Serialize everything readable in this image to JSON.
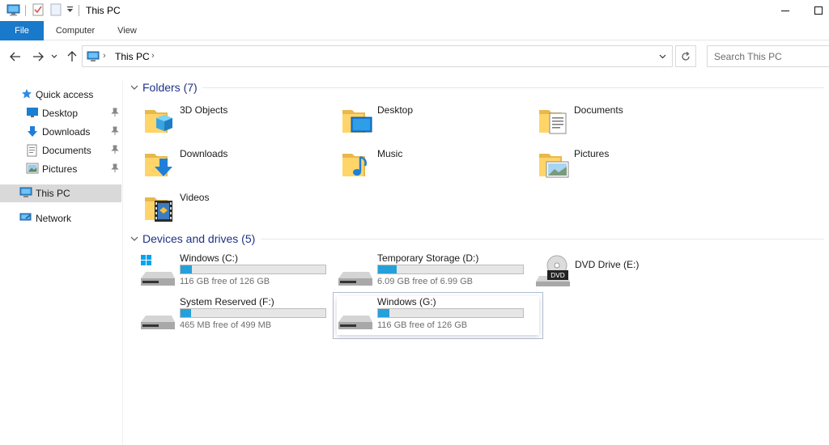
{
  "window": {
    "title": "This PC"
  },
  "ribbon": {
    "tabs": [
      {
        "label": "File"
      },
      {
        "label": "Computer"
      },
      {
        "label": "View"
      }
    ]
  },
  "address": {
    "location": "This PC",
    "search_placeholder": "Search This PC"
  },
  "nav": {
    "quick_access": "Quick access",
    "items": [
      {
        "label": "Desktop"
      },
      {
        "label": "Downloads"
      },
      {
        "label": "Documents"
      },
      {
        "label": "Pictures"
      }
    ],
    "this_pc": "This PC",
    "network": "Network"
  },
  "folders": {
    "heading": "Folders (7)",
    "items": [
      {
        "name": "3D Objects",
        "icon": "3d-objects-folder-icon"
      },
      {
        "name": "Desktop",
        "icon": "desktop-folder-icon"
      },
      {
        "name": "Documents",
        "icon": "documents-folder-icon"
      },
      {
        "name": "Downloads",
        "icon": "downloads-folder-icon"
      },
      {
        "name": "Music",
        "icon": "music-folder-icon"
      },
      {
        "name": "Pictures",
        "icon": "pictures-folder-icon"
      },
      {
        "name": "Videos",
        "icon": "videos-folder-icon"
      }
    ]
  },
  "drives": {
    "heading": "Devices and drives (5)",
    "items": [
      {
        "name": "Windows (C:)",
        "free": "116 GB free of 126 GB",
        "used_fraction": 0.08
      },
      {
        "name": "Temporary Storage (D:)",
        "free": "6.09 GB free of 6.99 GB",
        "used_fraction": 0.13
      },
      {
        "name": "DVD Drive (E:)"
      },
      {
        "name": "System Reserved (F:)",
        "free": "465 MB free of 499 MB",
        "used_fraction": 0.07
      },
      {
        "name": "Windows (G:)",
        "free": "116 GB free of 126 GB",
        "used_fraction": 0.08
      }
    ]
  },
  "colors": {
    "accent": "#1979ca",
    "usage_bar": "#26a0da",
    "section_heading": "#1e3287"
  }
}
